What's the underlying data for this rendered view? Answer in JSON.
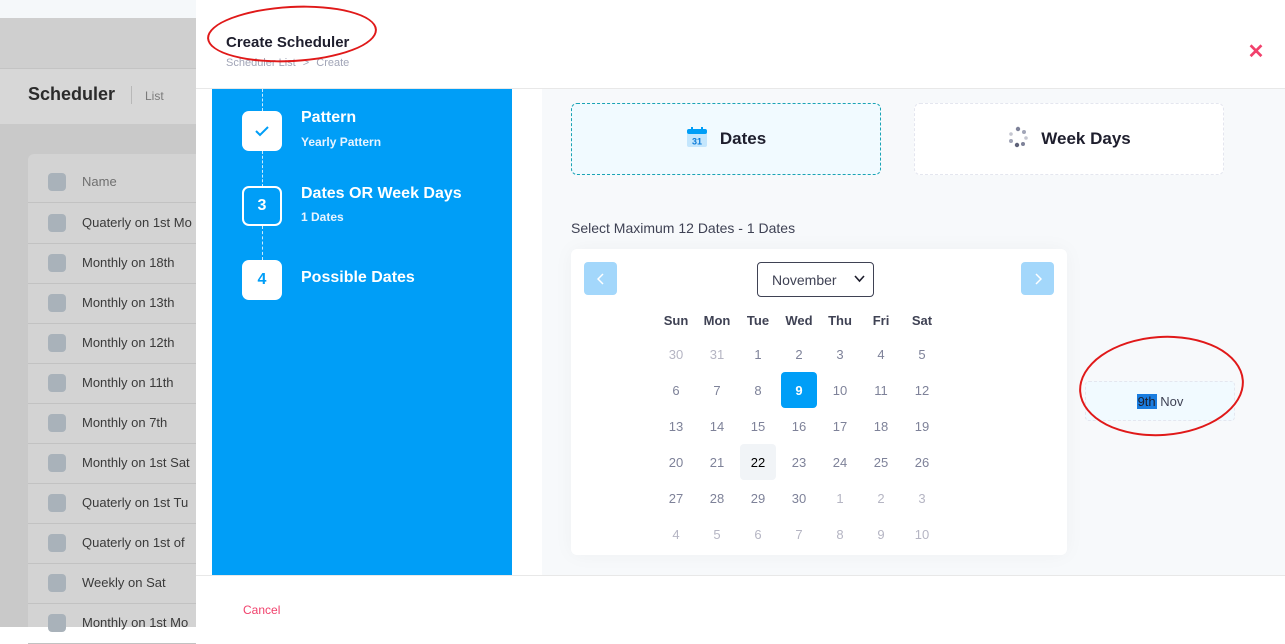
{
  "background": {
    "title": "Scheduler",
    "breadcrumb": "List",
    "table_header": "Name",
    "rows": [
      "Quaterly on 1st Mo",
      "Monthly on 18th",
      "Monthly on 13th",
      "Monthly on 12th",
      "Monthly on 11th",
      "Monthly on 7th",
      "Monthly on 1st Sat",
      "Quaterly on 1st Tu",
      "Quaterly on 1st of",
      "Weekly on Sat",
      "Monthly on 1st Mo"
    ]
  },
  "modal": {
    "title": "Create Scheduler",
    "breadcrumb": {
      "parent": "Scheduler List",
      "separator": ">",
      "current": "Create"
    },
    "close_icon": "close-icon"
  },
  "stepper": {
    "steps": [
      {
        "number": "",
        "title": "Pattern",
        "subtitle": "Yearly Pattern",
        "state": "done"
      },
      {
        "number": "3",
        "title": "Dates OR Week Days",
        "subtitle": "1 Dates",
        "state": "current"
      },
      {
        "number": "4",
        "title": "Possible Dates",
        "subtitle": "",
        "state": "todo"
      }
    ]
  },
  "options": {
    "dates_label": "Dates",
    "dates_icon": "calendar-icon",
    "dates_icon_text": "31",
    "weekdays_label": "Week Days",
    "weekdays_icon": "spinner-icon"
  },
  "select_label": "Select Maximum 12 Dates - 1 Dates",
  "calendar": {
    "month": "November",
    "weekdays": [
      "Sun",
      "Mon",
      "Tue",
      "Wed",
      "Thu",
      "Fri",
      "Sat"
    ],
    "weeks": [
      [
        [
          "30",
          "other"
        ],
        [
          "31",
          "other"
        ],
        [
          "1",
          "cur"
        ],
        [
          "2",
          "cur"
        ],
        [
          "3",
          "cur"
        ],
        [
          "4",
          "cur"
        ],
        [
          "5",
          "cur"
        ]
      ],
      [
        [
          "6",
          "cur"
        ],
        [
          "7",
          "cur"
        ],
        [
          "8",
          "cur"
        ],
        [
          "9",
          "selected"
        ],
        [
          "10",
          "cur"
        ],
        [
          "11",
          "cur"
        ],
        [
          "12",
          "cur"
        ]
      ],
      [
        [
          "13",
          "cur"
        ],
        [
          "14",
          "cur"
        ],
        [
          "15",
          "cur"
        ],
        [
          "16",
          "cur"
        ],
        [
          "17",
          "cur"
        ],
        [
          "18",
          "cur"
        ],
        [
          "19",
          "cur"
        ]
      ],
      [
        [
          "20",
          "cur"
        ],
        [
          "21",
          "cur"
        ],
        [
          "22",
          "today"
        ],
        [
          "23",
          "cur"
        ],
        [
          "24",
          "cur"
        ],
        [
          "25",
          "cur"
        ],
        [
          "26",
          "cur"
        ]
      ],
      [
        [
          "27",
          "cur"
        ],
        [
          "28",
          "cur"
        ],
        [
          "29",
          "cur"
        ],
        [
          "30",
          "cur"
        ],
        [
          "1",
          "other"
        ],
        [
          "2",
          "other"
        ],
        [
          "3",
          "other"
        ]
      ],
      [
        [
          "4",
          "other"
        ],
        [
          "5",
          "other"
        ],
        [
          "6",
          "other"
        ],
        [
          "7",
          "other"
        ],
        [
          "8",
          "other"
        ],
        [
          "9",
          "other"
        ],
        [
          "10",
          "other"
        ]
      ]
    ]
  },
  "selected_chip": {
    "day": "9th",
    "month": "Nov"
  },
  "footer": {
    "cancel_label": "Cancel"
  },
  "colors": {
    "primary": "#009ef7",
    "danger": "#f1416c",
    "annotation": "#e01919"
  }
}
